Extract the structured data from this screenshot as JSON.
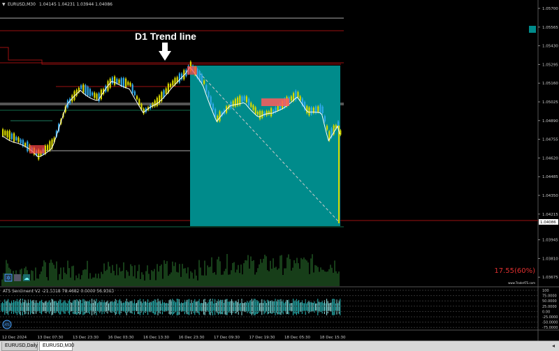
{
  "header": {
    "symbol": "EURUSD,M30",
    "ohlc": "1.04145 1.04231 1.03944 1.04086",
    "symbol_icon": "dropdown-triangle-icon"
  },
  "annotation": {
    "title": "D1 Trend line",
    "arrow": "down-arrow-icon"
  },
  "price_axis": {
    "labels": [
      "1.05700",
      "1.05565",
      "1.05430",
      "1.05295",
      "1.05160",
      "1.05025",
      "1.04890",
      "1.04755",
      "1.04620",
      "1.04485",
      "1.04350",
      "1.04215",
      "1.04086",
      "1.03945",
      "1.03810",
      "1.03675"
    ],
    "current": "1.04086"
  },
  "time_axis": {
    "labels": [
      "12 Dec 2024",
      "13 Dec 07:30",
      "13 Dec 23:30",
      "16 Dec 03:30",
      "16 Dec 13:30",
      "16 Dec 23:30",
      "17 Dec 09:30",
      "17 Dec 19:30",
      "18 Dec 05:30",
      "18 Dec 15:30"
    ]
  },
  "watermark": "www.TradeATS.com",
  "percent_text": "17.55(60%)",
  "indicator": {
    "title": "ATS Sentiment V2 -21.5318 78.4682 0.0000 56.9363",
    "levels": [
      "100",
      "75.0000",
      "50.0000",
      "25.0000",
      "0.00",
      "-25.0000",
      "-50.0000",
      "-75.0000"
    ],
    "logo_text": "ATS"
  },
  "toolbar_icons": [
    "gear-icon",
    "grid-icon",
    "cloud-icon"
  ],
  "tabs": {
    "inactive": "EURUSD,Daily",
    "active": "EURUSD,M30",
    "arrow": "◂"
  },
  "colors": {
    "teal": "#008b8b",
    "bull": "#2fa8e8",
    "bear": "#d8d800",
    "resistance": "#9c1010",
    "support": "#0f6b4a"
  }
}
